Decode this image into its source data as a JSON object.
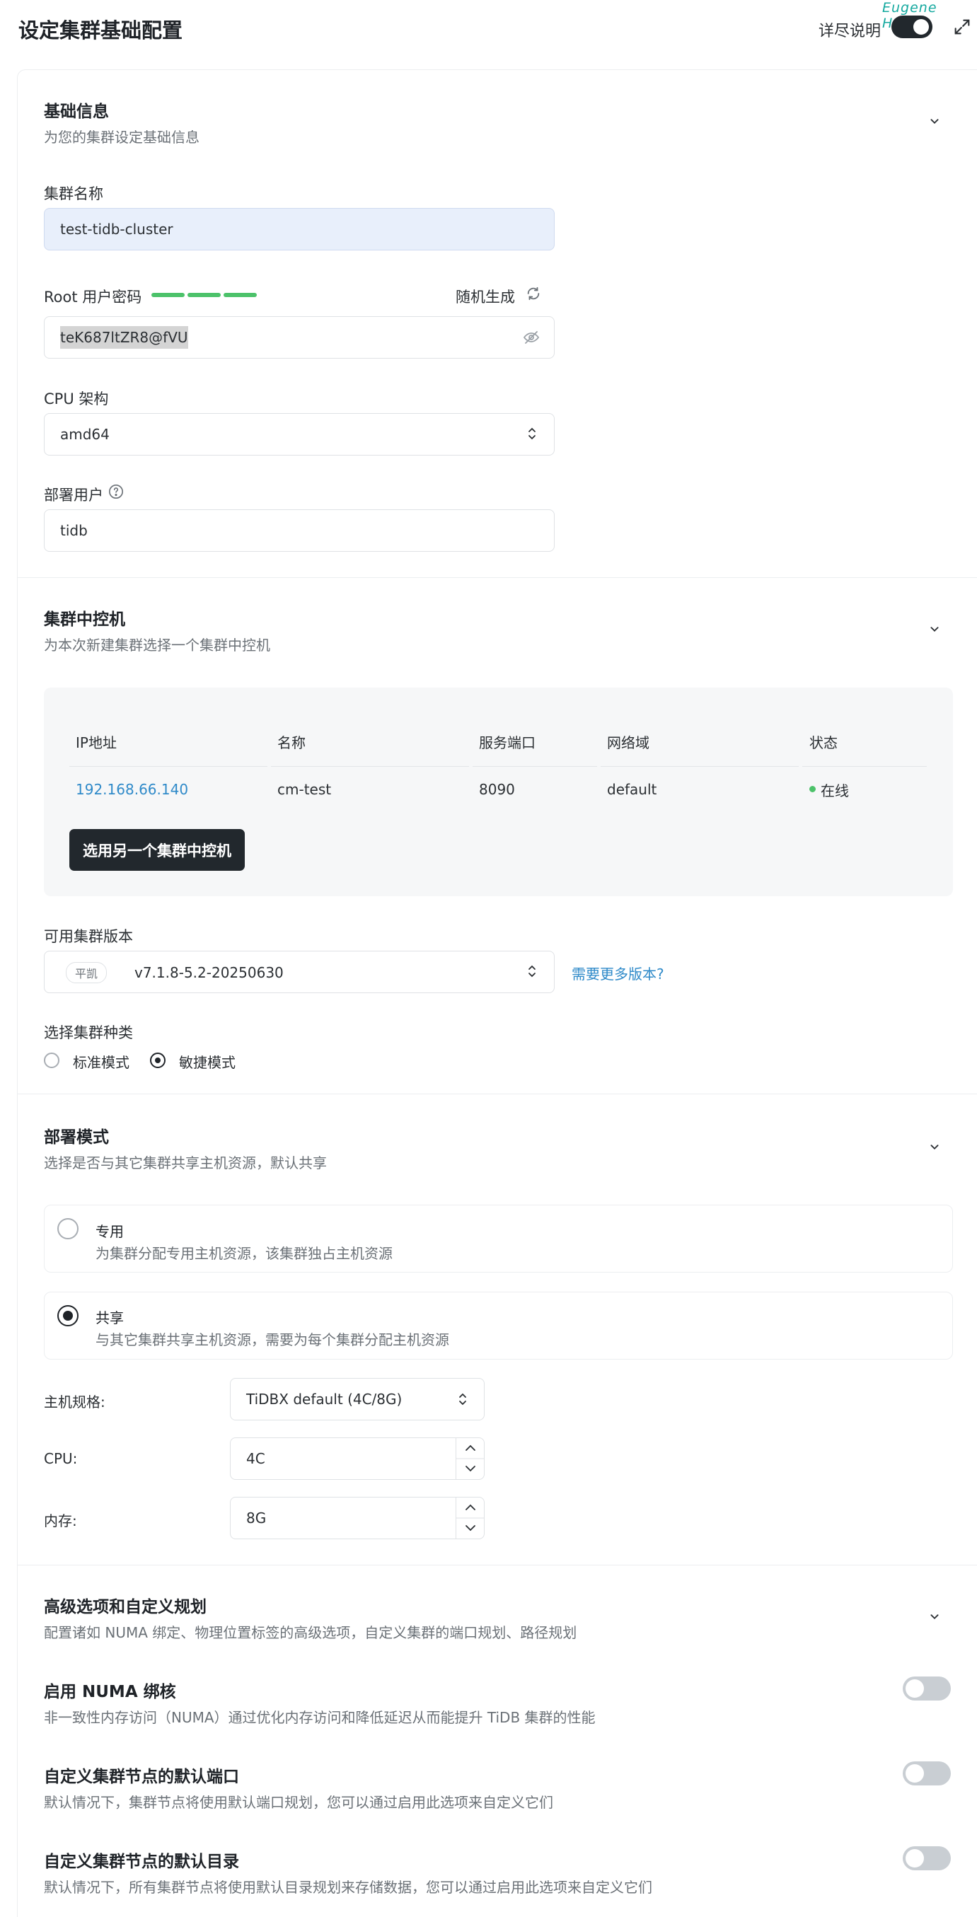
{
  "header": {
    "title": "设定集群基础配置",
    "detail_label": "详尽说明",
    "watermark": "Eugene Huang"
  },
  "basic": {
    "title": "基础信息",
    "subtitle": "为您的集群设定基础信息",
    "cluster_name_label": "集群名称",
    "cluster_name_value": "test-tidb-cluster",
    "root_password_label": "Root 用户密码",
    "random_generate": "随机生成",
    "password_value": "teK687ltZR8@fVU",
    "cpu_arch_label": "CPU 架构",
    "cpu_arch_value": "amd64",
    "deploy_user_label": "部署用户",
    "deploy_user_value": "tidb"
  },
  "controller": {
    "title": "集群中控机",
    "subtitle": "为本次新建集群选择一个集群中控机",
    "columns": [
      "IP地址",
      "名称",
      "服务端口",
      "网络域",
      "状态"
    ],
    "row": {
      "ip": "192.168.66.140",
      "name": "cm-test",
      "port": "8090",
      "domain": "default",
      "status": "在线"
    },
    "select_other_button": "选用另一个集群中控机",
    "version_label": "可用集群版本",
    "version_tag": "平凯",
    "version_value": "v7.1.8-5.2-20250630",
    "more_versions_link": "需要更多版本?",
    "cluster_type_label": "选择集群种类",
    "type_standard": "标准模式",
    "type_agile": "敏捷模式"
  },
  "deploy": {
    "title": "部署模式",
    "subtitle": "选择是否与其它集群共享主机资源，默认共享",
    "dedicated_title": "专用",
    "dedicated_desc": "为集群分配专用主机资源，该集群独占主机资源",
    "shared_title": "共享",
    "shared_desc": "与其它集群共享主机资源，需要为每个集群分配主机资源",
    "spec_label": "主机规格:",
    "spec_value": "TiDBX default (4C/8G)",
    "cpu_label": "CPU:",
    "cpu_value": "4C",
    "mem_label": "内存:",
    "mem_value": "8G"
  },
  "advanced": {
    "title": "高级选项和自定义规划",
    "subtitle": "配置诸如 NUMA 绑定、物理位置标签的高级选项，自定义集群的端口规划、路径规划",
    "numa_title": "启用 NUMA 绑核",
    "numa_desc": "非一致性内存访问（NUMA）通过优化内存访问和降低延迟从而能提升 TiDB 集群的性能",
    "port_title": "自定义集群节点的默认端口",
    "port_desc": "默认情况下，集群节点将使用默认端口规划，您可以通过启用此选项来自定义它们",
    "dir_title": "自定义集群节点的默认目录",
    "dir_desc": "默认情况下，所有集群节点将使用默认目录规划来存储数据，您可以通过启用此选项来自定义它们"
  },
  "colors": {
    "accent_dark": "#22282d",
    "link": "#2f8ac9",
    "success": "#4cc26a",
    "input_filled_bg": "#e8effb"
  },
  "icons": [
    "refresh-icon",
    "eye-off-icon",
    "chevron-updown-icon",
    "help-circle-icon",
    "chevron-down-icon",
    "expand-icon"
  ]
}
